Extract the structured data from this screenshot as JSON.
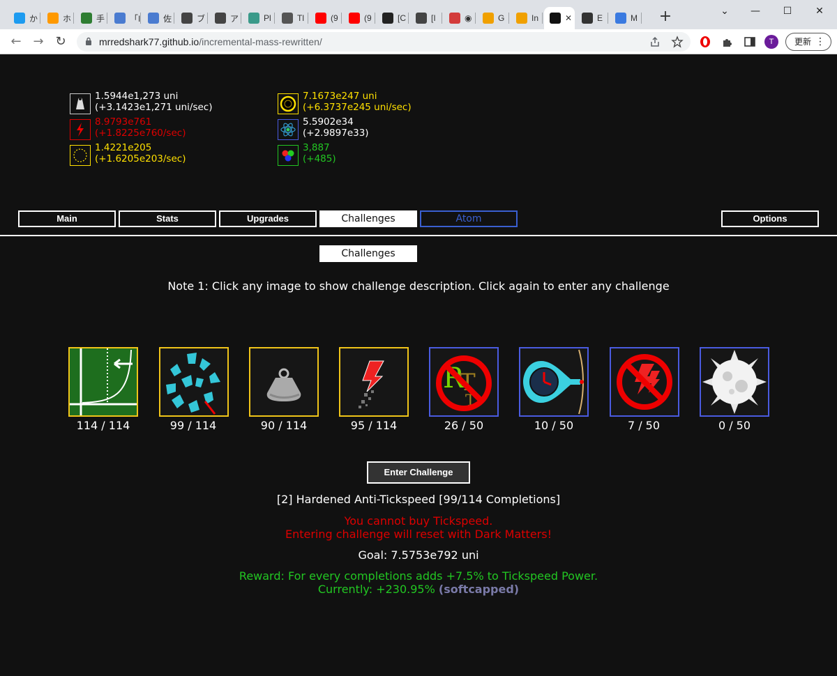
{
  "browser": {
    "tabs": [
      {
        "title": "か",
        "color": "#1d9bf0"
      },
      {
        "title": "ホ",
        "color": "#ff9900"
      },
      {
        "title": "手",
        "color": "#2e7d32"
      },
      {
        "title": "「I",
        "color": "#4a7bd0"
      },
      {
        "title": "佐",
        "color": "#4a7bd0"
      },
      {
        "title": "ブ",
        "color": "#444444"
      },
      {
        "title": "ア",
        "color": "#444444"
      },
      {
        "title": "Pl",
        "color": "#3a9a8a"
      },
      {
        "title": "Tl",
        "color": "#555555"
      },
      {
        "title": "(9",
        "color": "#ff0000"
      },
      {
        "title": "(9",
        "color": "#ff0000"
      },
      {
        "title": "[C",
        "color": "#222222"
      },
      {
        "title": "[I",
        "color": "#444444"
      },
      {
        "title": "◉",
        "color": "#d33b3b"
      },
      {
        "title": "G",
        "color": "#f0a000"
      },
      {
        "title": "In",
        "color": "#f0a000"
      },
      {
        "title": "",
        "color": "#111111",
        "active": true
      },
      {
        "title": "E",
        "color": "#333333"
      },
      {
        "title": "M",
        "color": "#3a7ae0"
      }
    ],
    "new_tab": "+",
    "window_controls": {
      "minimize": "—",
      "maximize": "☐",
      "close": "✕",
      "menu": "⌄"
    },
    "url_domain": "mrredshark77.github.io",
    "url_path": "/incremental-mass-rewritten/",
    "profile_initial": "T",
    "update_label": "更新"
  },
  "resources": {
    "mass": {
      "line1": "1.5944e1,273 uni",
      "line2": "(+3.1423e1,271 uni/sec)",
      "icon": "weight-icon"
    },
    "rage": {
      "line1": "8.9793e761",
      "line2": "(+1.8225e760/sec)",
      "icon": "lightning-icon"
    },
    "dark_matter": {
      "line1": "1.4221e205",
      "line2": "(+1.6205e203/sec)",
      "icon": "dark-circle-icon"
    },
    "black_hole": {
      "line1": "7.1673e247 uni",
      "line2": "(+6.3737e245 uni/sec)",
      "icon": "black-hole-icon"
    },
    "atom": {
      "line1": "5.5902e34",
      "line2": "(+2.9897e33)",
      "icon": "atom-icon"
    },
    "quark": {
      "line1": "3,887",
      "line2": "(+485)",
      "icon": "quark-icon"
    }
  },
  "tabs": {
    "main": "Main",
    "stats": "Stats",
    "upgrades": "Upgrades",
    "challenges": "Challenges",
    "atom": "Atom",
    "options": "Options"
  },
  "subtab": "Challenges",
  "note": "Note 1: Click any image to show challenge description. Click again to enter any challenge",
  "challenges": [
    {
      "count": "114 / 114",
      "icon": "instant-scale-icon"
    },
    {
      "count": "99 / 114",
      "icon": "anti-tickspeed-icon"
    },
    {
      "count": "90 / 114",
      "icon": "melted-mass-icon"
    },
    {
      "count": "95 / 114",
      "icon": "weakened-rage-icon"
    },
    {
      "count": "26 / 50",
      "icon": "no-rank-icon"
    },
    {
      "count": "10 / 50",
      "icon": "no-tickspeed-condenser-icon"
    },
    {
      "count": "7 / 50",
      "icon": "no-rage-icon"
    },
    {
      "count": "0 / 50",
      "icon": "white-hole-icon"
    }
  ],
  "enter_button": "Enter Challenge",
  "detail": {
    "title": "[2] Hardened Anti-Tickspeed [99/114 Completions]",
    "warning1": "You cannot buy Tickspeed.",
    "warning2": "Entering challenge will reset with Dark Matters!",
    "goal": "Goal: 7.5753e792 uni",
    "reward": "Reward: For every completions adds +7.5% to Tickspeed Power.",
    "current": "Currently: +230.95%",
    "softcapped": "(softcapped)"
  },
  "colors": {
    "white": "#ffffff",
    "yellow": "#ffe000",
    "red": "#dd0000",
    "green": "#22c622",
    "atom_blue": "#3a5fd0",
    "gold_border": "#f0c419",
    "blue_border": "#4a5be0"
  }
}
